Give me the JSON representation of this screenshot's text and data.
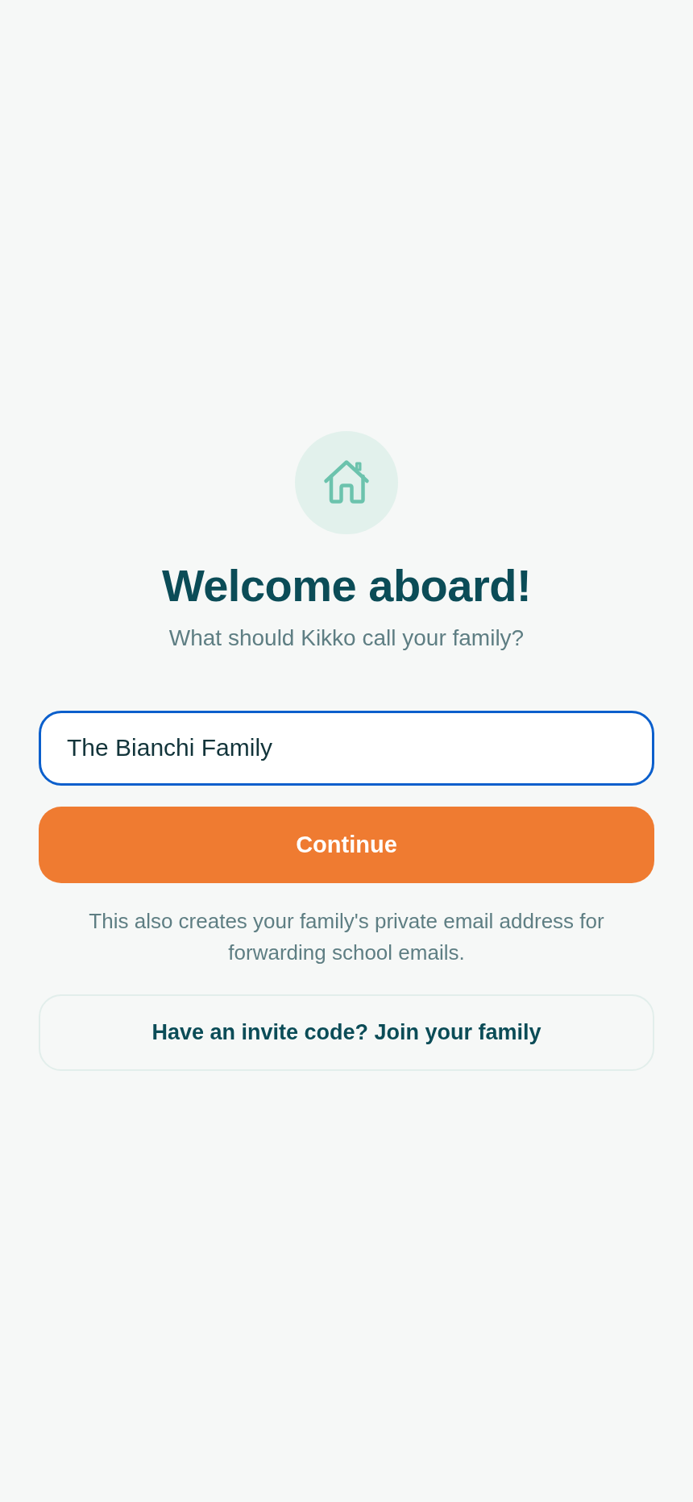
{
  "header": {
    "title": "Welcome aboard!",
    "subtitle": "What should Kikko call your family?"
  },
  "form": {
    "family_name": {
      "value": "The Bianchi Family",
      "focused": true
    },
    "primary_button": "Continue",
    "note": "This also creates your family's private email address for forwarding school emails.",
    "secondary_button": "Have an invite code? Join your family"
  }
}
